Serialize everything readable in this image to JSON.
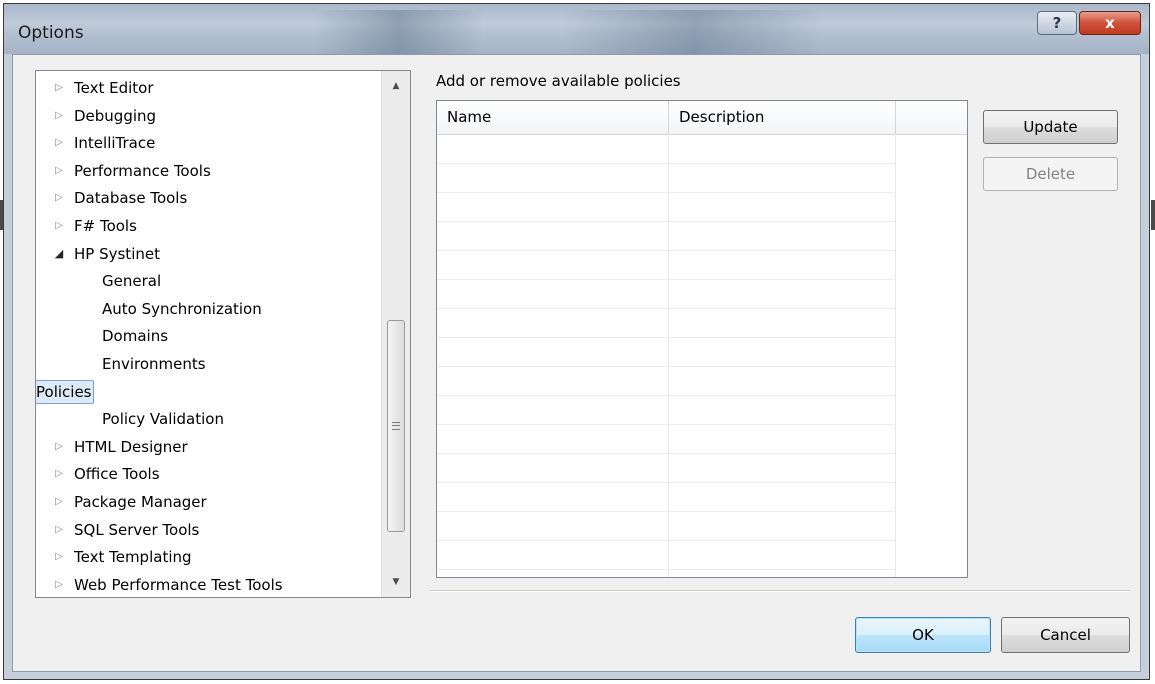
{
  "window": {
    "title": "Options",
    "help_label": "?",
    "close_label": "x"
  },
  "tree": {
    "items": [
      {
        "label": "Text Editor",
        "level": 0,
        "expander": "collapsed"
      },
      {
        "label": "Debugging",
        "level": 0,
        "expander": "collapsed"
      },
      {
        "label": "IntelliTrace",
        "level": 0,
        "expander": "collapsed"
      },
      {
        "label": "Performance Tools",
        "level": 0,
        "expander": "collapsed"
      },
      {
        "label": "Database Tools",
        "level": 0,
        "expander": "collapsed"
      },
      {
        "label": "F# Tools",
        "level": 0,
        "expander": "collapsed"
      },
      {
        "label": "HP Systinet",
        "level": 0,
        "expander": "expanded"
      },
      {
        "label": "General",
        "level": 1,
        "expander": "none"
      },
      {
        "label": "Auto Synchronization",
        "level": 1,
        "expander": "none"
      },
      {
        "label": "Domains",
        "level": 1,
        "expander": "none"
      },
      {
        "label": "Environments",
        "level": 1,
        "expander": "none"
      },
      {
        "label": "Policies",
        "level": 1,
        "expander": "none",
        "selected": true
      },
      {
        "label": "Policy Validation",
        "level": 1,
        "expander": "none"
      },
      {
        "label": "HTML Designer",
        "level": 0,
        "expander": "collapsed"
      },
      {
        "label": "Office Tools",
        "level": 0,
        "expander": "collapsed"
      },
      {
        "label": "Package Manager",
        "level": 0,
        "expander": "collapsed"
      },
      {
        "label": "SQL Server Tools",
        "level": 0,
        "expander": "collapsed"
      },
      {
        "label": "Text Templating",
        "level": 0,
        "expander": "collapsed"
      },
      {
        "label": "Web Performance Test Tools",
        "level": 0,
        "expander": "collapsed"
      }
    ],
    "icons": {
      "collapsed": "▷",
      "expanded": "◢",
      "scroll_up": "▲",
      "scroll_down": "▼"
    }
  },
  "policies": {
    "heading": "Add or remove available policies",
    "columns": [
      "Name",
      "Description",
      ""
    ],
    "rows": [],
    "empty_rows_visible": 15
  },
  "buttons": {
    "update": "Update",
    "delete": "Delete",
    "ok": "OK",
    "cancel": "Cancel"
  },
  "colors": {
    "selection_fill": "#dceaf8",
    "selection_border": "#7da2ce",
    "close_button": "#c13a22",
    "default_button_border": "#3c7fb1"
  }
}
